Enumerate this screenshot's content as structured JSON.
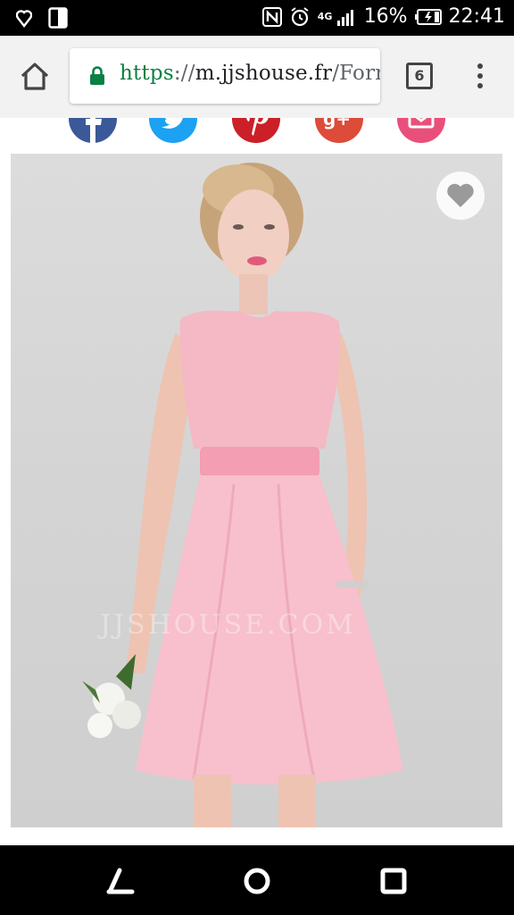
{
  "status_bar": {
    "network": "4G",
    "battery_percent": "16%",
    "time": "22:41"
  },
  "browser": {
    "url_scheme": "https",
    "url_separator": "://",
    "url_host": "m.jjshouse.fr",
    "url_path": "/Forr",
    "tab_count": "6"
  },
  "share_buttons": [
    {
      "name": "facebook",
      "color": "#3b5998"
    },
    {
      "name": "twitter",
      "color": "#1da1f2"
    },
    {
      "name": "pinterest",
      "color": "#cb2027"
    },
    {
      "name": "google-plus",
      "color": "#dd4b39"
    },
    {
      "name": "email",
      "color": "#e8507a"
    }
  ],
  "product_image": {
    "watermark": "JJSHOUSE.COM",
    "wishlist_icon": "heart-icon"
  }
}
